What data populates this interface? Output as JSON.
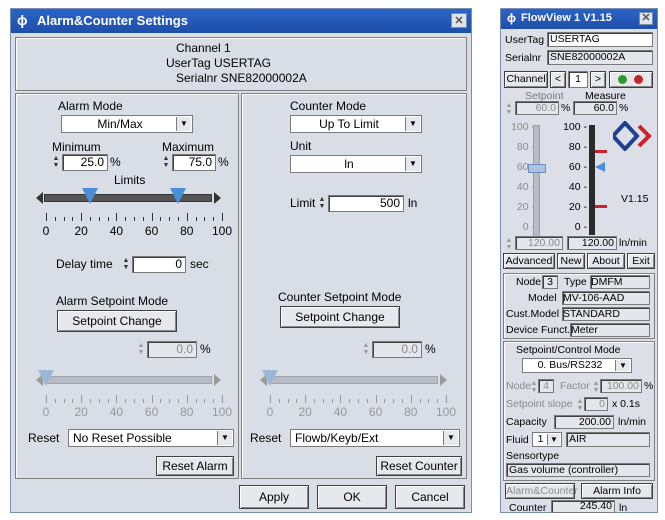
{
  "alarm_window": {
    "title": "Alarm&Counter Settings",
    "header": {
      "channel": "Channel  1",
      "usertag": "UserTag  USERTAG",
      "serial": "Serialnr  SNE82000002A"
    },
    "alarm": {
      "mode_label": "Alarm Mode",
      "mode_value": "Min/Max",
      "min_label": "Minimum",
      "min_value": "25.0",
      "max_label": "Maximum",
      "max_value": "75.0",
      "unit": "%",
      "limits_label": "Limits",
      "slider_min_value": 25,
      "slider_max_value": 75,
      "scale": [
        "0",
        "20",
        "40",
        "60",
        "80",
        "100"
      ],
      "delay_label": "Delay time",
      "delay_value": "0",
      "delay_unit": "sec",
      "setpoint_mode_label": "Alarm Setpoint Mode",
      "setpoint_change_button": "Setpoint Change",
      "setpoint_value": "0.0",
      "setpoint_unit": "%",
      "setpoint_slider_value": 0,
      "reset_label": "Reset",
      "reset_value": "No Reset Possible",
      "reset_button": "Reset Alarm"
    },
    "counter": {
      "mode_label": "Counter Mode",
      "mode_value": "Up To Limit",
      "unit_label": "Unit",
      "unit_value": "ln",
      "limit_label": "Limit",
      "limit_value": "500",
      "limit_unit": "ln",
      "setpoint_mode_label": "Counter Setpoint Mode",
      "setpoint_change_button": "Setpoint Change",
      "setpoint_value": "0.0",
      "setpoint_unit": "%",
      "setpoint_slider_value": 0,
      "scale": [
        "0",
        "20",
        "40",
        "60",
        "80",
        "100"
      ],
      "reset_label": "Reset",
      "reset_value": "Flowb/Keyb/Ext",
      "reset_button": "Reset Counter"
    },
    "footer": {
      "apply": "Apply",
      "ok": "OK",
      "cancel": "Cancel"
    }
  },
  "flowview": {
    "title": "FlowView 1  V1.15",
    "usertag_label": "UserTag",
    "usertag_value": "USERTAG",
    "serial_label": "Serialnr",
    "serial_value": "SNE82000002A",
    "channel_button": "Channel",
    "channel_prev": "<",
    "channel_value": "1",
    "channel_next": ">",
    "setpoint_label": "Setpoint",
    "measure_label": "Measure",
    "setpoint_value": "60.0",
    "measure_value": "60.0",
    "percent": "%",
    "gauge_scale": [
      "100",
      "80",
      "60",
      "40",
      "20",
      "0"
    ],
    "gauge_setpoint_value": 60,
    "gauge_measure_value": 60,
    "version_label": "V1.15",
    "setpoint_flow": "120.00",
    "measure_flow": "120.00",
    "flow_unit": "ln/min",
    "nav": {
      "advanced": "Advanced",
      "new": "New",
      "about": "About",
      "exit": "Exit"
    },
    "node_label": "Node",
    "node_value": "3",
    "type_label": "Type",
    "type_value": "DMFM",
    "model_label": "Model",
    "model_value": "MV-106-AAD",
    "custmodel_label": "Cust.Model",
    "custmodel_value": "STANDARD",
    "devfunc_label": "Device Funct.",
    "devfunc_value": "Meter",
    "control_mode_label": "Setpoint/Control Mode",
    "control_mode_value": "0. Bus/RS232",
    "node2_label": "Node",
    "node2_value": "4",
    "factor_label": "Factor",
    "factor_value": "100.00",
    "factor_unit": "%",
    "slope_label": "Setpoint slope",
    "slope_value": "0",
    "slope_unit": "x 0.1s",
    "capacity_label": "Capacity",
    "capacity_value": "200.00",
    "capacity_unit": "ln/min",
    "fluid_label": "Fluid",
    "fluid_value": "1",
    "fluid_name": "AIR",
    "sensortype_label": "Sensortype",
    "sensortype_value": "Gas volume (controller)",
    "alarm_counter_button": "Alarm&Counter",
    "alarm_info_button": "Alarm Info",
    "counter_label": "Counter",
    "counter_value": "245.40",
    "counter_unit": "ln",
    "colors": {
      "green_led": "#2e9a2e",
      "red_led": "#c0262a",
      "logo_blue": "#1f3f8f",
      "logo_red": "#d0202a"
    }
  }
}
